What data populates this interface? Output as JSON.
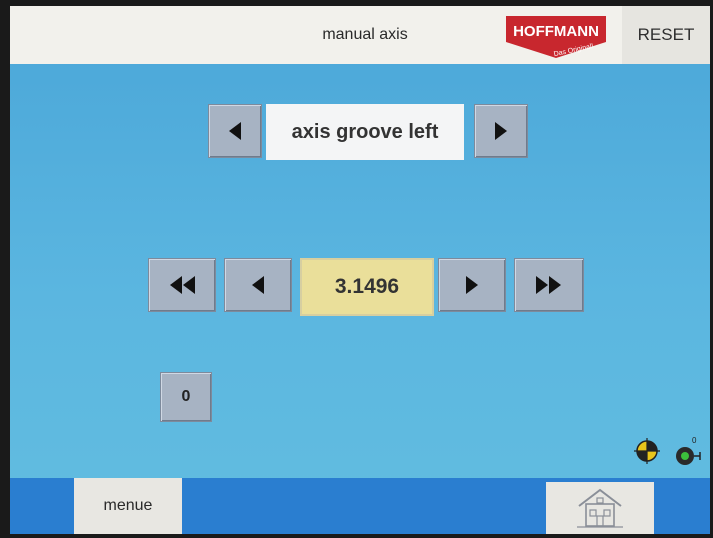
{
  "header": {
    "title": "manual axis",
    "reset_label": "RESET"
  },
  "logo": {
    "brand": "HOFFMANN",
    "tagline": "Das Original!"
  },
  "axis_selector": {
    "value": "axis groove left"
  },
  "position": {
    "value": "3.1496"
  },
  "zero_button": {
    "label": "0"
  },
  "footer": {
    "menu_label": "menue"
  },
  "colors": {
    "screen": "#5bb6e0",
    "button": "#a7b3c3",
    "value_bg": "#eadf9a",
    "footer": "#2a7ed0",
    "logo_red": "#c8272e"
  },
  "icons": [
    "arrow-left-icon",
    "arrow-right-icon",
    "fast-rewind-icon",
    "fast-forward-icon",
    "target-icon",
    "switch-icon",
    "home-icon"
  ]
}
